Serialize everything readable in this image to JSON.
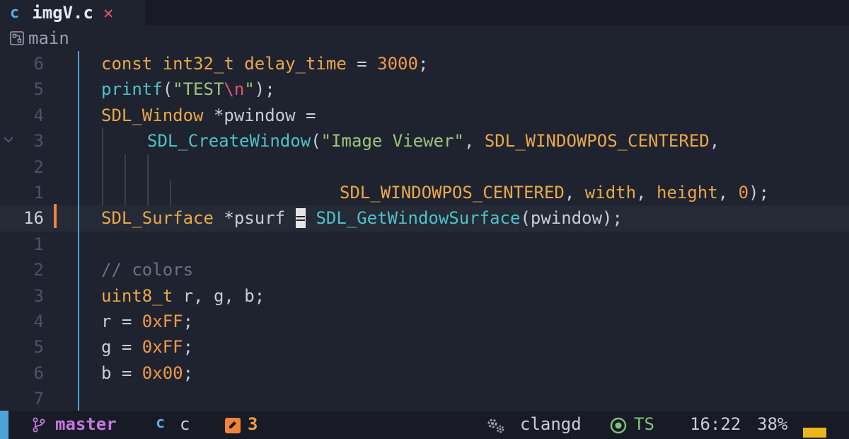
{
  "tab": {
    "lang_icon": "c",
    "filename": "imgV.c",
    "close_icon": "✕"
  },
  "breadcrumb": {
    "label": "main"
  },
  "lines": [
    {
      "num": "6"
    },
    {
      "num": "5"
    },
    {
      "num": "4"
    },
    {
      "num": "3"
    },
    {
      "num": "2"
    },
    {
      "num": "1"
    },
    {
      "num": "16"
    },
    {
      "num": "1"
    },
    {
      "num": "2"
    },
    {
      "num": "3"
    },
    {
      "num": "4"
    },
    {
      "num": "5"
    },
    {
      "num": "6"
    },
    {
      "num": "7"
    }
  ],
  "code": {
    "l1": [
      "const int32_t delay_time",
      " = ",
      "3000",
      ";"
    ],
    "l2": [
      "printf",
      "(",
      "\"TEST",
      "\\n",
      "\"",
      ");"
    ],
    "l3": [
      "SDL_Window",
      " *pwindow ="
    ],
    "l4": [
      "SDL_CreateWindow",
      "(",
      "\"Image Viewer\"",
      ", ",
      "SDL_WINDOWPOS_CENTERED",
      ","
    ],
    "l6": [
      "SDL_WINDOWPOS_CENTERED",
      ", ",
      "width",
      ", ",
      "height",
      ", ",
      "0",
      ");"
    ],
    "l7": [
      "SDL_Surface",
      " *psurf ",
      "=",
      " ",
      "SDL_GetWindowSurface",
      "(pwindow);"
    ],
    "l9": [
      "// colors"
    ],
    "l10": [
      "uint8_t",
      " r, g, b;"
    ],
    "l11": [
      "r = ",
      "0xFF",
      ";"
    ],
    "l12": [
      "g = ",
      "0xFF",
      ";"
    ],
    "l13": [
      "b = ",
      "0x00",
      ";"
    ]
  },
  "statusbar": {
    "branch": "master",
    "lang_icon": "c",
    "lang": "c",
    "diagnostics": "3",
    "lsp": "clangd",
    "treesitter": "TS",
    "time": "16:22",
    "percent": "38%",
    "scroll_percent": 38
  },
  "colors": {
    "bg": "#1f2330",
    "keyword": "#e8a848",
    "string": "#9bc67a",
    "function": "#4fc1c6",
    "number": "#f0994a",
    "accent_blue": "#4da3d8",
    "branch": "#c678dd"
  },
  "icons": {
    "breadcrumb": "namespace-icon",
    "branch": "git-branch-icon",
    "diagnostics": "pencil-square-icon",
    "lsp": "gears-icon",
    "treesitter": "target-circle-icon",
    "fold": "chevron-down-icon"
  }
}
